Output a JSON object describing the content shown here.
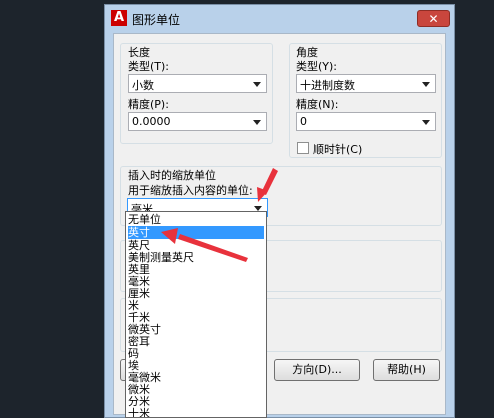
{
  "dialog": {
    "title": "图形单位",
    "close_glyph": "✕",
    "app_logo": "A"
  },
  "length": {
    "group_title": "长度",
    "type_label": "类型(T):",
    "type_value": "小数",
    "precision_label": "精度(P):",
    "precision_value": "0.0000"
  },
  "angle": {
    "group_title": "角度",
    "type_label": "类型(Y):",
    "type_value": "十进制度数",
    "precision_label": "精度(N):",
    "precision_value": "0",
    "clockwise_label": "顺时针(C)",
    "clockwise_checked": false
  },
  "insertion": {
    "group_title": "插入时的缩放单位",
    "description": "用于缩放插入内容的单位:",
    "current_value": "毫米",
    "options": [
      "无单位",
      "英寸",
      "英尺",
      "美制测量英尺",
      "英里",
      "毫米",
      "厘米",
      "米",
      "千米",
      "微英寸",
      "密耳",
      "码",
      "埃",
      "毫微米",
      "微米",
      "分米",
      "十米"
    ],
    "selected_index": 1
  },
  "buttons": {
    "direction_label": "方向(D)...",
    "help_label": "帮助(H)"
  },
  "annotation_color": "#e8323c",
  "accent_color": "#3399ff"
}
